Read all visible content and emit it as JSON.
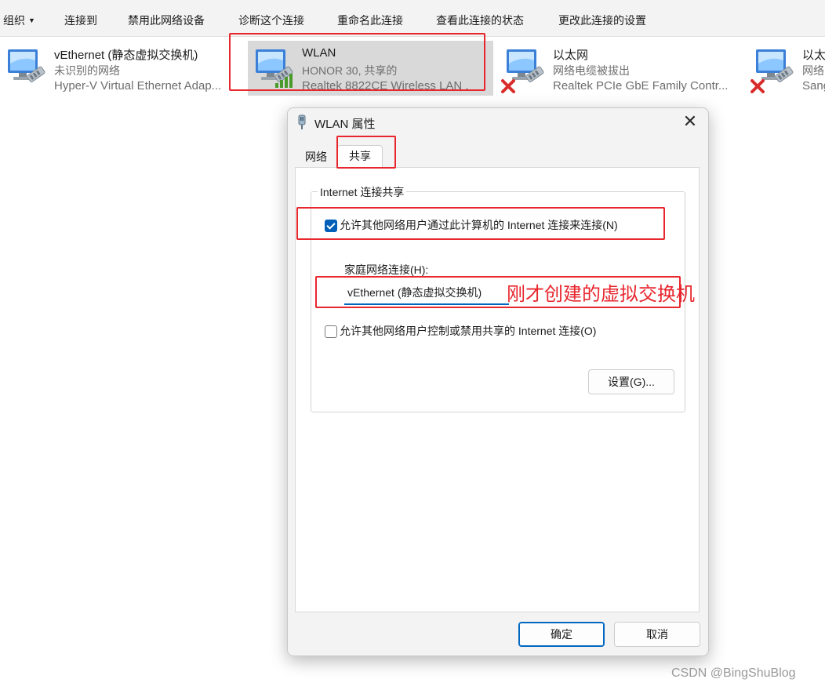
{
  "toolbar": {
    "organize": "组织",
    "connect_to": "连接到",
    "disable_device": "禁用此网络设备",
    "diagnose": "诊断这个连接",
    "rename": "重命名此连接",
    "view_status": "查看此连接的状态",
    "change_settings": "更改此连接的设置"
  },
  "adapters": [
    {
      "name": "vEthernet (静态虚拟交换机)",
      "status": "未识别的网络",
      "device": "Hyper-V Virtual Ethernet Adap..."
    },
    {
      "name": "WLAN",
      "status": "HONOR 30, 共享的",
      "device": "Realtek 8822CE Wireless LAN ..."
    },
    {
      "name": "以太网",
      "status": "网络电缆被拔出",
      "device": "Realtek PCIe GbE Family Contr..."
    },
    {
      "name": "以太",
      "status": "网络",
      "device": "Sang"
    }
  ],
  "dialog": {
    "title": "WLAN 属性",
    "close": "✕",
    "tabs": [
      "网络",
      "共享"
    ],
    "group_title": "Internet 连接共享",
    "allow_connect": "允许其他网络用户通过此计算机的 Internet 连接来连接(N)",
    "allow_connect_checked": true,
    "home_network_label": "家庭网络连接(H):",
    "home_network_value": "vEthernet (静态虚拟交换机)",
    "allow_control": "允许其他网络用户控制或禁用共享的 Internet 连接(O)",
    "allow_control_checked": false,
    "settings_button": "设置(G)...",
    "ok_button": "确定",
    "cancel_button": "取消"
  },
  "annotation": "刚才创建的虚拟交换机",
  "watermark": "CSDN @BingShuBlog",
  "colors": {
    "accent": "#005fb8",
    "highlight_box": "#e8262d",
    "selected_tile": "#d9d9d9",
    "error_x": "#d82c2c",
    "signal_green": "#4a9a2b"
  },
  "icons": {
    "adapter": "network-adapter-icon",
    "disconnected": "red-x-icon",
    "wifi": "wifi-signal-icon",
    "dialog": "network-plug-icon"
  }
}
